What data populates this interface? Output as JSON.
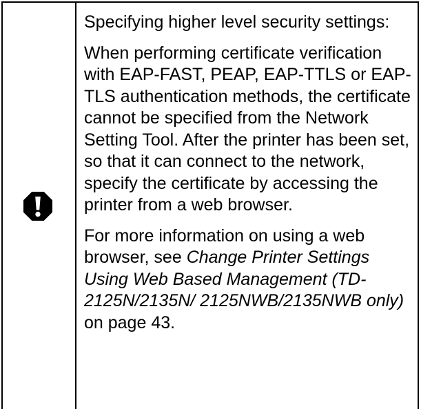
{
  "note": {
    "icon": "exclamation-icon",
    "heading": "Specifying higher level security settings:",
    "body": "When performing certificate verification with EAP-FAST, PEAP, EAP-TTLS or EAP-TLS authentication methods, the certificate cannot be specified from the Network Setting Tool. After the printer has been set, so that it can connect to the network, specify the certificate by accessing the printer from a web browser.",
    "more_info_prefix": "For more information on using a web browser, see ",
    "more_info_link": "Change Printer Settings Using Web Based Management (TD-2125N/2135N/ 2125NWB/2135NWB only)",
    "more_info_suffix": " on page 43."
  }
}
